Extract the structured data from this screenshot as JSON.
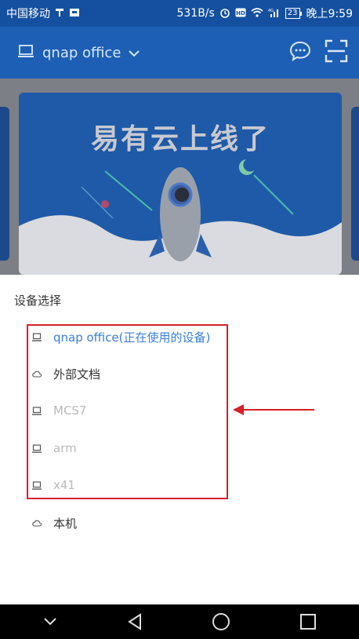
{
  "status_bar": {
    "carrier": "中国移动",
    "network_speed": "531B/s",
    "battery": "23",
    "time": "晚上9:59"
  },
  "header": {
    "device_name": "qnap office"
  },
  "banner": {
    "title": "易有云上线了"
  },
  "sheet": {
    "title": "设备选择",
    "items": [
      {
        "label": "qnap office(正在使用的设备)",
        "icon": "laptop-icon",
        "state": "active"
      },
      {
        "label": "外部文档",
        "icon": "cloud-icon",
        "state": "normal"
      },
      {
        "label": "MCS7",
        "icon": "laptop-icon",
        "state": "disabled"
      },
      {
        "label": "arm",
        "icon": "laptop-icon",
        "state": "disabled"
      },
      {
        "label": "x41",
        "icon": "laptop-icon",
        "state": "disabled"
      },
      {
        "label": "本机",
        "icon": "cloud-icon",
        "state": "normal"
      }
    ]
  },
  "colors": {
    "header": "#1c5fb4",
    "active_text": "#3a7fd5",
    "annotation_red": "#d8202a"
  }
}
